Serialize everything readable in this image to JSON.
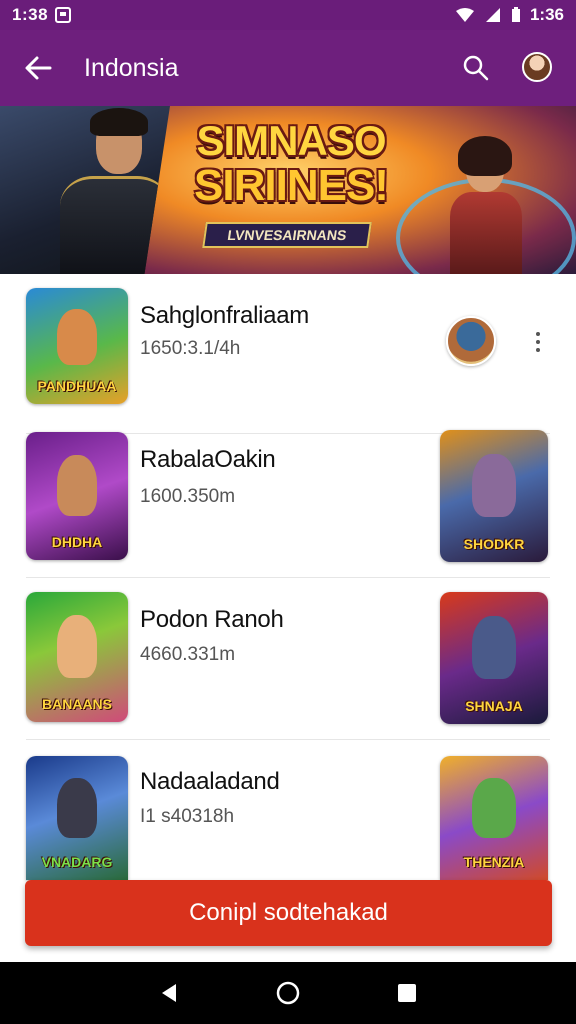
{
  "status_bar": {
    "time": "1:38",
    "battery": "1:36"
  },
  "app_bar": {
    "title": "Indonsia"
  },
  "banner": {
    "title_line1": "SIMNASO",
    "title_line2": "SIRIINES!",
    "tagline": "LVNVESAIRNANS"
  },
  "items": [
    {
      "name": "Sahglonfraliaam",
      "sub": "1650:3.1/4h",
      "thumb_caption": "PANDHUAA",
      "trailing": "avatar"
    },
    {
      "name": "RabalaOakin",
      "sub": "1600.350m",
      "thumb_caption": "DHDHA",
      "right_caption": "SHODKR"
    },
    {
      "name": "Podon Ranoh",
      "sub": "4660.331m",
      "thumb_caption": "BANAANS",
      "right_caption": "SHNAJA"
    },
    {
      "name": "Nadaaladand",
      "sub": "I1 s40318h",
      "thumb_caption": "VNADARG",
      "right_caption": "THENZIA"
    }
  ],
  "cta": {
    "label": "Conipl sodtehakad"
  },
  "colors": {
    "app_bar": "#6e1f7d",
    "status_bar": "#6a1d7a",
    "cta": "#d9321c"
  }
}
